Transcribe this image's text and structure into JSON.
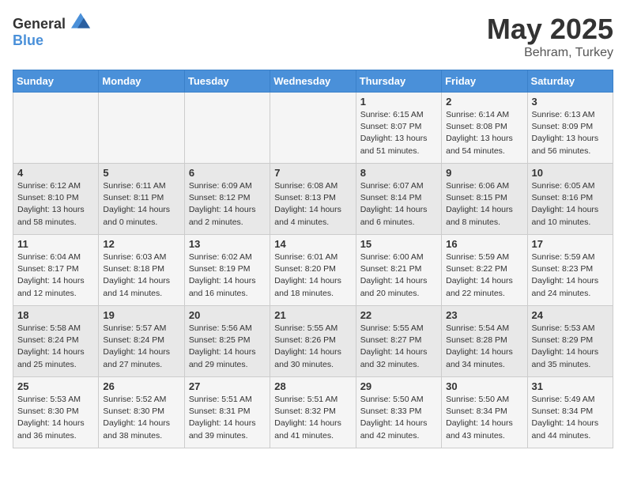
{
  "header": {
    "logo_general": "General",
    "logo_blue": "Blue",
    "title": "May 2025",
    "subtitle": "Behram, Turkey"
  },
  "days_of_week": [
    "Sunday",
    "Monday",
    "Tuesday",
    "Wednesday",
    "Thursday",
    "Friday",
    "Saturday"
  ],
  "weeks": [
    [
      {
        "day": "",
        "info": ""
      },
      {
        "day": "",
        "info": ""
      },
      {
        "day": "",
        "info": ""
      },
      {
        "day": "",
        "info": ""
      },
      {
        "day": "1",
        "info": "Sunrise: 6:15 AM\nSunset: 8:07 PM\nDaylight: 13 hours and 51 minutes."
      },
      {
        "day": "2",
        "info": "Sunrise: 6:14 AM\nSunset: 8:08 PM\nDaylight: 13 hours and 54 minutes."
      },
      {
        "day": "3",
        "info": "Sunrise: 6:13 AM\nSunset: 8:09 PM\nDaylight: 13 hours and 56 minutes."
      }
    ],
    [
      {
        "day": "4",
        "info": "Sunrise: 6:12 AM\nSunset: 8:10 PM\nDaylight: 13 hours and 58 minutes."
      },
      {
        "day": "5",
        "info": "Sunrise: 6:11 AM\nSunset: 8:11 PM\nDaylight: 14 hours and 0 minutes."
      },
      {
        "day": "6",
        "info": "Sunrise: 6:09 AM\nSunset: 8:12 PM\nDaylight: 14 hours and 2 minutes."
      },
      {
        "day": "7",
        "info": "Sunrise: 6:08 AM\nSunset: 8:13 PM\nDaylight: 14 hours and 4 minutes."
      },
      {
        "day": "8",
        "info": "Sunrise: 6:07 AM\nSunset: 8:14 PM\nDaylight: 14 hours and 6 minutes."
      },
      {
        "day": "9",
        "info": "Sunrise: 6:06 AM\nSunset: 8:15 PM\nDaylight: 14 hours and 8 minutes."
      },
      {
        "day": "10",
        "info": "Sunrise: 6:05 AM\nSunset: 8:16 PM\nDaylight: 14 hours and 10 minutes."
      }
    ],
    [
      {
        "day": "11",
        "info": "Sunrise: 6:04 AM\nSunset: 8:17 PM\nDaylight: 14 hours and 12 minutes."
      },
      {
        "day": "12",
        "info": "Sunrise: 6:03 AM\nSunset: 8:18 PM\nDaylight: 14 hours and 14 minutes."
      },
      {
        "day": "13",
        "info": "Sunrise: 6:02 AM\nSunset: 8:19 PM\nDaylight: 14 hours and 16 minutes."
      },
      {
        "day": "14",
        "info": "Sunrise: 6:01 AM\nSunset: 8:20 PM\nDaylight: 14 hours and 18 minutes."
      },
      {
        "day": "15",
        "info": "Sunrise: 6:00 AM\nSunset: 8:21 PM\nDaylight: 14 hours and 20 minutes."
      },
      {
        "day": "16",
        "info": "Sunrise: 5:59 AM\nSunset: 8:22 PM\nDaylight: 14 hours and 22 minutes."
      },
      {
        "day": "17",
        "info": "Sunrise: 5:59 AM\nSunset: 8:23 PM\nDaylight: 14 hours and 24 minutes."
      }
    ],
    [
      {
        "day": "18",
        "info": "Sunrise: 5:58 AM\nSunset: 8:24 PM\nDaylight: 14 hours and 25 minutes."
      },
      {
        "day": "19",
        "info": "Sunrise: 5:57 AM\nSunset: 8:24 PM\nDaylight: 14 hours and 27 minutes."
      },
      {
        "day": "20",
        "info": "Sunrise: 5:56 AM\nSunset: 8:25 PM\nDaylight: 14 hours and 29 minutes."
      },
      {
        "day": "21",
        "info": "Sunrise: 5:55 AM\nSunset: 8:26 PM\nDaylight: 14 hours and 30 minutes."
      },
      {
        "day": "22",
        "info": "Sunrise: 5:55 AM\nSunset: 8:27 PM\nDaylight: 14 hours and 32 minutes."
      },
      {
        "day": "23",
        "info": "Sunrise: 5:54 AM\nSunset: 8:28 PM\nDaylight: 14 hours and 34 minutes."
      },
      {
        "day": "24",
        "info": "Sunrise: 5:53 AM\nSunset: 8:29 PM\nDaylight: 14 hours and 35 minutes."
      }
    ],
    [
      {
        "day": "25",
        "info": "Sunrise: 5:53 AM\nSunset: 8:30 PM\nDaylight: 14 hours and 36 minutes."
      },
      {
        "day": "26",
        "info": "Sunrise: 5:52 AM\nSunset: 8:30 PM\nDaylight: 14 hours and 38 minutes."
      },
      {
        "day": "27",
        "info": "Sunrise: 5:51 AM\nSunset: 8:31 PM\nDaylight: 14 hours and 39 minutes."
      },
      {
        "day": "28",
        "info": "Sunrise: 5:51 AM\nSunset: 8:32 PM\nDaylight: 14 hours and 41 minutes."
      },
      {
        "day": "29",
        "info": "Sunrise: 5:50 AM\nSunset: 8:33 PM\nDaylight: 14 hours and 42 minutes."
      },
      {
        "day": "30",
        "info": "Sunrise: 5:50 AM\nSunset: 8:34 PM\nDaylight: 14 hours and 43 minutes."
      },
      {
        "day": "31",
        "info": "Sunrise: 5:49 AM\nSunset: 8:34 PM\nDaylight: 14 hours and 44 minutes."
      }
    ]
  ]
}
